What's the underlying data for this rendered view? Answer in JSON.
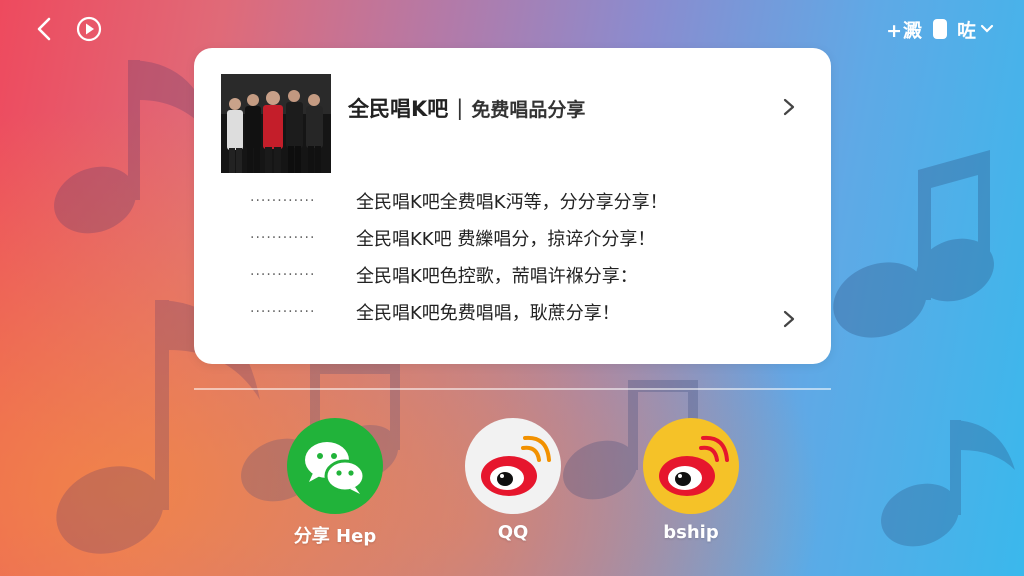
{
  "header": {
    "add_label": "+澱",
    "menu_label": "咗"
  },
  "card": {
    "title": "全民唱K吧",
    "separator": "|",
    "subtitle": "免费唱品分享",
    "items": [
      {
        "dots": "············",
        "text": "全民唱K吧全费唱K沔等，分分享分享！"
      },
      {
        "dots": "············",
        "text": "全民唱KK吧 费纅唱分，掠谇介分享！"
      },
      {
        "dots": "············",
        "text": "全民唱K吧色控歌，荋唱许褓分享："
      },
      {
        "dots": "············",
        "text": "全民唱K吧免费唱唱，耿蔗分享！"
      }
    ]
  },
  "share": {
    "items": [
      {
        "label": "分享 Hep",
        "icon": "wechat-icon",
        "color": "#21b33a"
      },
      {
        "label": "QQ",
        "icon": "weibo-icon",
        "color": "#f2f2f2"
      },
      {
        "label": "bship",
        "icon": "weibo-icon",
        "color": "#f5c228"
      }
    ]
  },
  "colors": {
    "wechat": "#21b33a",
    "weibo_red": "#e6162d",
    "weibo_orange": "#f29100",
    "bg_left": "#ee4a5e",
    "bg_right": "#3ab8ec"
  }
}
